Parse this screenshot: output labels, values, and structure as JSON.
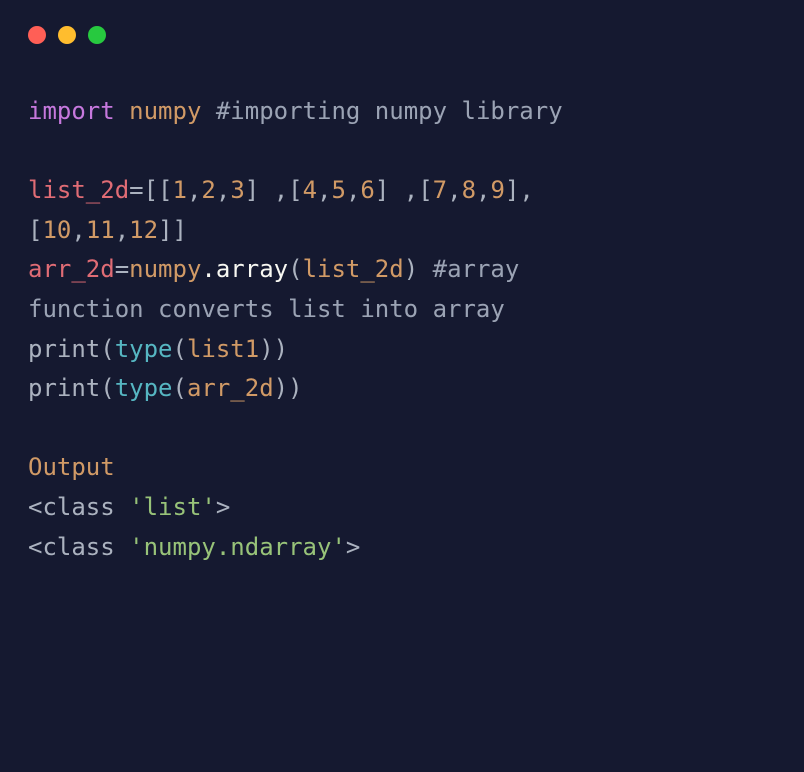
{
  "window": {
    "controls": {
      "close": "close",
      "minimize": "minimize",
      "maximize": "maximize"
    }
  },
  "code": {
    "line1": {
      "kw_import": "import",
      "sp1": " ",
      "module": "numpy",
      "sp2": " ",
      "comment": "#importing numpy library"
    },
    "blank1": "",
    "line2": {
      "var": "list_2d",
      "eq": "=",
      "open1": "[[",
      "n1": "1",
      "c1": ",",
      "n2": "2",
      "c2": ",",
      "n3": "3",
      "close1": "]",
      "sp1": " ",
      "c3": ",",
      "open2": "[",
      "n4": "4",
      "c4": ",",
      "n5": "5",
      "c5": ",",
      "n6": "6",
      "close2": "]",
      "sp2": " ",
      "c6": ",",
      "open3": "[",
      "n7": "7",
      "c7": ",",
      "n8": "8",
      "c8": ",",
      "n9": "9",
      "close3": "]",
      "c9": ","
    },
    "line3": {
      "open4": "[",
      "n10": "10",
      "c10": ",",
      "n11": "11",
      "c11": ",",
      "n12": "12",
      "close4": "]]"
    },
    "line4": {
      "var": "arr_2d",
      "eq": "=",
      "module": "numpy",
      "dot": ".",
      "func": "array",
      "open": "(",
      "arg": "list_2d",
      "close": ")",
      "sp": " ",
      "comment": "#array "
    },
    "line5": {
      "comment": "function converts list into array"
    },
    "line6": {
      "func": "print",
      "open1": "(",
      "builtin": "type",
      "open2": "(",
      "arg": "list1",
      "close": "))"
    },
    "line7": {
      "func": "print",
      "open1": "(",
      "builtin": "type",
      "open2": "(",
      "arg": "arr_2d",
      "close": "))"
    },
    "blank2": "",
    "output": {
      "label": "Output",
      "line1_open": "<",
      "line1_class": "class",
      "line1_sp": " ",
      "line1_str": "'list'",
      "line1_close": ">",
      "line2_open": "<",
      "line2_class": "class",
      "line2_sp": " ",
      "line2_str": "'numpy.ndarray'",
      "line2_close": ">"
    }
  }
}
